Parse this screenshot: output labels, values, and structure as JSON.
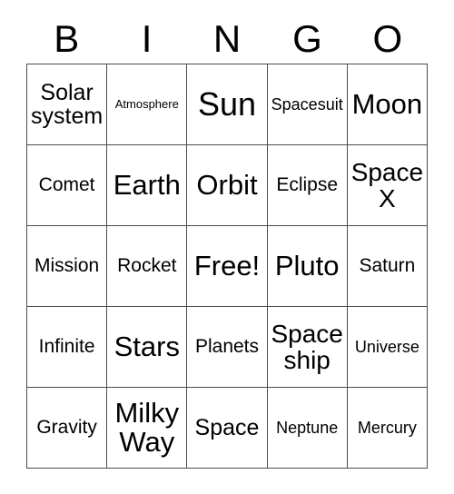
{
  "card": {
    "title": "BINGO",
    "header_letters": [
      "B",
      "I",
      "N",
      "G",
      "O"
    ],
    "free_space_label": "Free!",
    "colors": {
      "background": "#ffffff",
      "text": "#000000",
      "grid_line": "#4d4d4d"
    },
    "grid": {
      "columns": 5,
      "rows": 5,
      "cells": [
        [
          {
            "label": "Solar system",
            "size": "lg"
          },
          {
            "label": "Atmosphere",
            "size": "xs"
          },
          {
            "label": "Sun",
            "size": "3xl"
          },
          {
            "label": "Spacesuit",
            "size": "sm"
          },
          {
            "label": "Moon",
            "size": "2xl"
          }
        ],
        [
          {
            "label": "Comet",
            "size": "md"
          },
          {
            "label": "Earth",
            "size": "2xl"
          },
          {
            "label": "Orbit",
            "size": "2xl"
          },
          {
            "label": "Eclipse",
            "size": "md"
          },
          {
            "label": "Space X",
            "size": "xl"
          }
        ],
        [
          {
            "label": "Mission",
            "size": "md"
          },
          {
            "label": "Rocket",
            "size": "md"
          },
          {
            "label": "Free!",
            "size": "2xl"
          },
          {
            "label": "Pluto",
            "size": "2xl"
          },
          {
            "label": "Saturn",
            "size": "md"
          }
        ],
        [
          {
            "label": "Infinite",
            "size": "md"
          },
          {
            "label": "Stars",
            "size": "2xl"
          },
          {
            "label": "Planets",
            "size": "md"
          },
          {
            "label": "Space ship",
            "size": "xl"
          },
          {
            "label": "Universe",
            "size": "sm"
          }
        ],
        [
          {
            "label": "Gravity",
            "size": "md"
          },
          {
            "label": "Milky Way",
            "size": "2xl"
          },
          {
            "label": "Space",
            "size": "lg"
          },
          {
            "label": "Neptune",
            "size": "sm"
          },
          {
            "label": "Mercury",
            "size": "sm"
          }
        ]
      ]
    }
  }
}
